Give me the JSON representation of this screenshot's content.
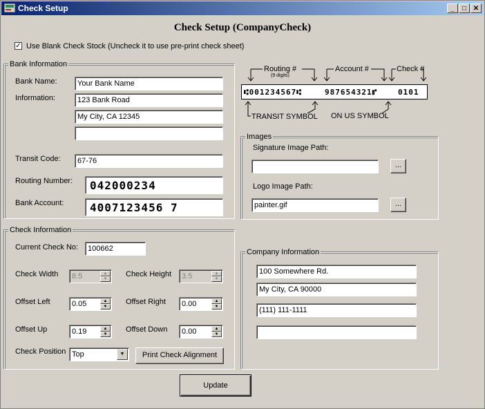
{
  "window": {
    "title": "Check Setup",
    "min_label": "_",
    "max_label": "□",
    "close_label": "✕"
  },
  "heading": "Check Setup (CompanyCheck)",
  "blank_stock": {
    "checked": true,
    "check_mark": "✓",
    "label": "Use Blank Check Stock (Uncheck it to use pre-print check sheet)"
  },
  "bank": {
    "group_label": "Bank Information",
    "name_label": "Bank Name:",
    "name_value": "Your Bank Name",
    "info_label": "Information:",
    "info_line1": "123 Bank Road",
    "info_line2": "My City, CA 12345",
    "info_line3": "",
    "transit_label": "Transit Code:",
    "transit_value": "67-76",
    "routing_label": "Routing Number:",
    "routing_value": "042000234",
    "account_label": "Bank Account:",
    "account_value": "4007123456 7"
  },
  "diagram": {
    "routing_label": "Routing #",
    "routing_sub": "(9 digits)",
    "account_label": "Account #",
    "check_label": "Check #",
    "sample_routing": "⑆001234567⑆",
    "sample_account": "987654321⑈",
    "sample_check": "0101",
    "transit_symbol_label": "TRANSIT SYMBOL",
    "onus_symbol_label": "ON US SYMBOL"
  },
  "images": {
    "group_label": "Images",
    "signature_label": "Signature Image Path:",
    "signature_value": "",
    "logo_label": "Logo Image Path:",
    "logo_value": "painter.gif",
    "browse_label": "..."
  },
  "check_info": {
    "group_label": "Check Information",
    "current_no_label": "Current Check No:",
    "current_no_value": "100662",
    "width_label": "Check Width",
    "width_value": "8.5",
    "height_label": "Check Height",
    "height_value": "3.5",
    "offset_left_label": "Offset Left",
    "offset_left_value": "0.05",
    "offset_right_label": "Offset Right",
    "offset_right_value": "0.00",
    "offset_up_label": "Offset Up",
    "offset_up_value": "0.19",
    "offset_down_label": "Offset Down",
    "offset_down_value": "0.00",
    "position_label": "Check Position",
    "position_value": "Top",
    "print_alignment_label": "Print Check Alignment",
    "spin_up": "▲",
    "spin_down": "▼",
    "drop_arrow": "▼"
  },
  "company": {
    "group_label": "Company Information",
    "line1": "100 Somewhere Rd.",
    "line2": "My City, CA 90000",
    "line3": "(111) 111-1111",
    "line4": ""
  },
  "update_label": "Update"
}
